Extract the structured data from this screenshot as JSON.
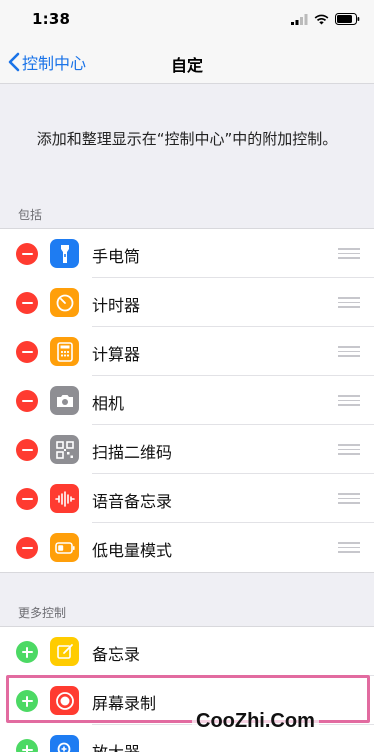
{
  "status_bar": {
    "time": "1:38"
  },
  "nav": {
    "back_label": "控制中心",
    "title": "自定"
  },
  "intro_text": "添加和整理显示在“控制中心”中的附加控制。",
  "included": {
    "header": "包括",
    "items": [
      {
        "label": "手电筒",
        "icon": "flashlight-icon",
        "color": "#1e7cf2"
      },
      {
        "label": "计时器",
        "icon": "timer-icon",
        "color": "#ff9f0a"
      },
      {
        "label": "计算器",
        "icon": "calculator-icon",
        "color": "#ff9f0a"
      },
      {
        "label": "相机",
        "icon": "camera-icon",
        "color": "#8e8e93"
      },
      {
        "label": "扫描二维码",
        "icon": "qr-code-icon",
        "color": "#8e8e93"
      },
      {
        "label": "语音备忘录",
        "icon": "voice-memo-icon",
        "color": "#ff3b30"
      },
      {
        "label": "低电量模式",
        "icon": "low-power-icon",
        "color": "#ff9f0a"
      }
    ]
  },
  "more": {
    "header": "更多控制",
    "items": [
      {
        "label": "备忘录",
        "icon": "notes-icon",
        "color": "#ffcc00"
      },
      {
        "label": "屏幕录制",
        "icon": "screen-record-icon",
        "color": "#ff3b30"
      },
      {
        "label": "放大器",
        "icon": "magnifier-icon",
        "color": "#1e7cf2"
      }
    ]
  },
  "watermark": "CooZhi.Com"
}
